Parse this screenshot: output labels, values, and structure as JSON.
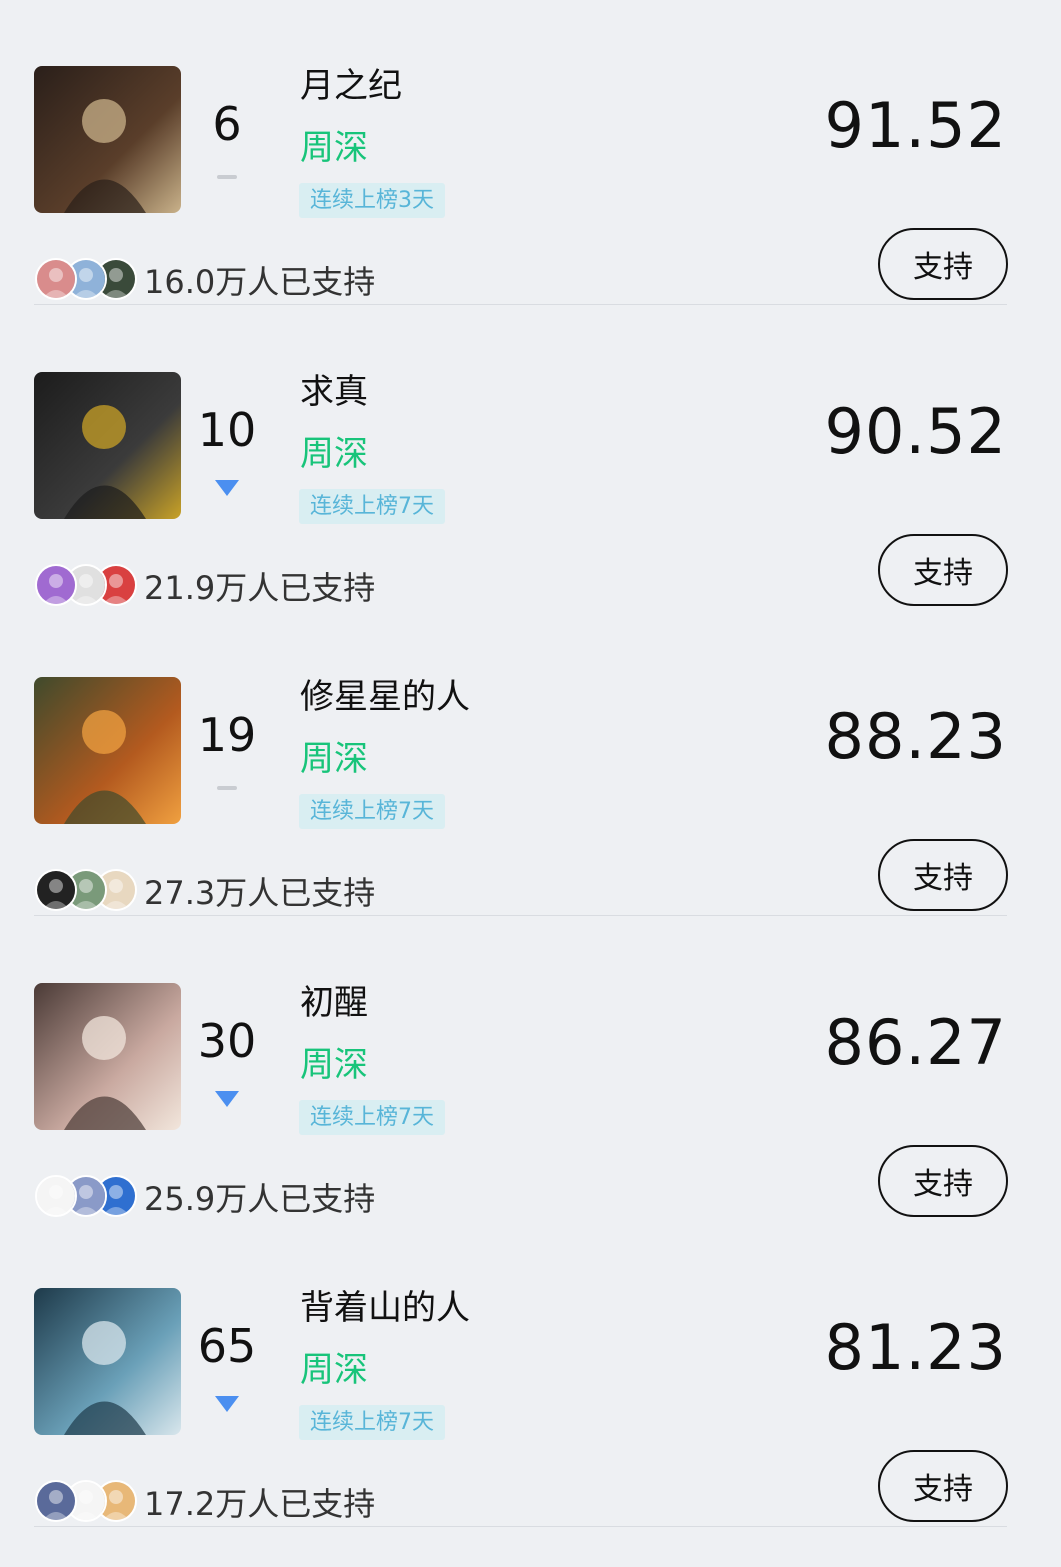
{
  "entries": [
    {
      "rank": "6",
      "trend": "flat",
      "title": "月之纪",
      "singer": "周深",
      "streak": "连续上榜3天",
      "score": "91.52",
      "supporters": "16.0万人已支持",
      "support_label": "支持",
      "divider": true,
      "cover_colors": [
        "#2a1f1a",
        "#5a3e2a",
        "#c9b28a"
      ],
      "avatar_colors": [
        "#d98c8c",
        "#8fb2d9",
        "#3a4a3a"
      ]
    },
    {
      "rank": "10",
      "trend": "down",
      "title": "求真",
      "singer": "周深",
      "streak": "连续上榜7天",
      "score": "90.52",
      "supporters": "21.9万人已支持",
      "support_label": "支持",
      "divider": false,
      "cover_colors": [
        "#1c1c1c",
        "#3b3b3b",
        "#c9a227"
      ],
      "avatar_colors": [
        "#a06ad1",
        "#e0e0e0",
        "#d94040"
      ]
    },
    {
      "rank": "19",
      "trend": "flat",
      "title": "修星星的人",
      "singer": "周深",
      "streak": "连续上榜7天",
      "score": "88.23",
      "supporters": "27.3万人已支持",
      "support_label": "支持",
      "divider": true,
      "cover_colors": [
        "#3f4a2c",
        "#b35a1f",
        "#f0a040"
      ],
      "avatar_colors": [
        "#222222",
        "#7a9a7a",
        "#e8d8c0"
      ]
    },
    {
      "rank": "30",
      "trend": "down",
      "title": "初醒",
      "singer": "周深",
      "streak": "连续上榜7天",
      "score": "86.27",
      "supporters": "25.9万人已支持",
      "support_label": "支持",
      "divider": false,
      "cover_colors": [
        "#4a3a36",
        "#c9a9a0",
        "#f2e6dc"
      ],
      "avatar_colors": [
        "#f5f5f5",
        "#8a9ac8",
        "#2f6fd0"
      ]
    },
    {
      "rank": "65",
      "trend": "down",
      "title": "背着山的人",
      "singer": "周深",
      "streak": "连续上榜7天",
      "score": "81.23",
      "supporters": "17.2万人已支持",
      "support_label": "支持",
      "divider": true,
      "cover_colors": [
        "#1e3a4a",
        "#6aa0b8",
        "#d8e6ec"
      ],
      "avatar_colors": [
        "#5a6a9a",
        "#f5f5f5",
        "#e8b878"
      ]
    }
  ]
}
